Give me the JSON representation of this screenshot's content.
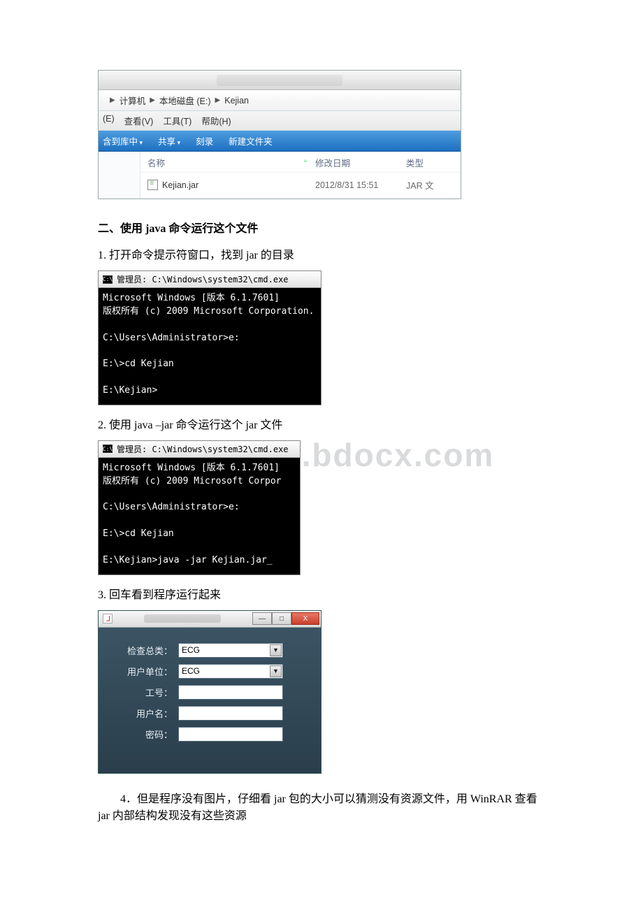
{
  "explorer": {
    "breadcrumb": {
      "seg1": "计算机",
      "seg2": "本地磁盘 (E:)",
      "seg3": "Kejian"
    },
    "menu": {
      "edit": "(E)",
      "view": "查看(V)",
      "tools": "工具(T)",
      "help": "帮助(H)"
    },
    "toolbar": {
      "include": "含到库中",
      "share": "共享",
      "burn": "刻录",
      "newfolder": "新建文件夹"
    },
    "columns": {
      "name": "名称",
      "modified": "修改日期",
      "type": "类型"
    },
    "row": {
      "name": "Kejian.jar",
      "modified": "2012/8/31 15:51",
      "type": "JAR 文"
    }
  },
  "doc": {
    "heading2": "二、使用 java 命令运行这个文件",
    "step1": "1. 打开命令提示符窗口，找到 jar 的目录",
    "step2": "2. 使用 java –jar 命令运行这个 jar 文件",
    "step3": "3. 回车看到程序运行起来",
    "step4": "4．但是程序没有图片，仔细看 jar 包的大小可以猜测没有资源文件，用 WinRAR 查看 jar 内部结构发现没有这些资源"
  },
  "watermark": "www.bdocx.com",
  "cmd1": {
    "title": "管理员: C:\\Windows\\system32\\cmd.exe",
    "line1": "Microsoft Windows [版本 6.1.7601]",
    "line2": "版权所有 (c) 2009 Microsoft Corporation.",
    "line3": "C:\\Users\\Administrator>e:",
    "line4": "E:\\>cd Kejian",
    "line5": "E:\\Kejian>"
  },
  "cmd2": {
    "title": "管理员: C:\\Windows\\system32\\cmd.exe",
    "line1": "Microsoft Windows [版本 6.1.7601]",
    "line2": "版权所有 (c) 2009 Microsoft Corpor",
    "line3": "C:\\Users\\Administrator>e:",
    "line4": "E:\\>cd Kejian",
    "line5": "E:\\Kejian>java -jar Kejian.jar_"
  },
  "app": {
    "labels": {
      "checkType": "检查总类：",
      "userUnit": "用户单位：",
      "workerNo": "工号：",
      "username": "用户名：",
      "password": "密码："
    },
    "values": {
      "checkType": "ECG",
      "userUnit": "ECG",
      "workerNo": "",
      "username": "",
      "password": ""
    },
    "winbtns": {
      "min": "—",
      "max": "□",
      "close": "X"
    }
  }
}
